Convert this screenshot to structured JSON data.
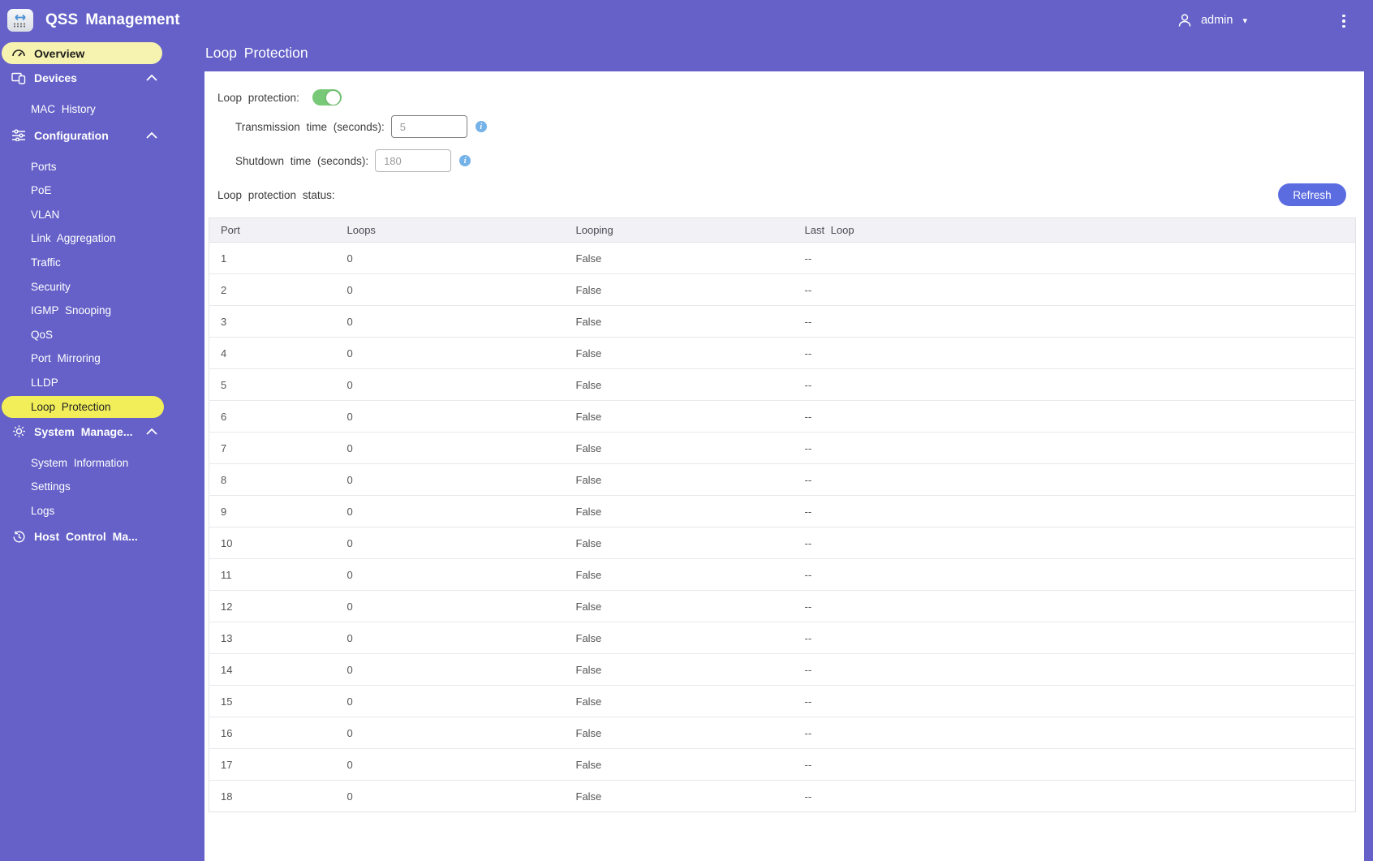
{
  "header": {
    "app_title": "QSS Management",
    "user": "admin"
  },
  "sidebar": {
    "overview": "Overview",
    "devices": {
      "label": "Devices",
      "items": [
        "MAC History"
      ]
    },
    "configuration": {
      "label": "Configuration",
      "items": [
        "Ports",
        "PoE",
        "VLAN",
        "Link Aggregation",
        "Traffic",
        "Security",
        "IGMP Snooping",
        "QoS",
        "Port Mirroring",
        "LLDP",
        "Loop Protection"
      ]
    },
    "system_management": {
      "label": "System Manage...",
      "items": [
        "System Information",
        "Settings",
        "Logs"
      ]
    },
    "host_control": {
      "label": "Host Control Ma..."
    }
  },
  "page": {
    "title": "Loop Protection",
    "toggle_label": "Loop protection:",
    "toggle_state": "on",
    "transmission": {
      "label": "Transmission time (seconds):",
      "value": "5"
    },
    "shutdown": {
      "label": "Shutdown time (seconds):",
      "value": "180"
    },
    "status_label": "Loop protection status:",
    "refresh_label": "Refresh"
  },
  "table": {
    "columns": [
      "Port",
      "Loops",
      "Looping",
      "Last Loop"
    ],
    "rows": [
      [
        "1",
        "0",
        "False",
        "--"
      ],
      [
        "2",
        "0",
        "False",
        "--"
      ],
      [
        "3",
        "0",
        "False",
        "--"
      ],
      [
        "4",
        "0",
        "False",
        "--"
      ],
      [
        "5",
        "0",
        "False",
        "--"
      ],
      [
        "6",
        "0",
        "False",
        "--"
      ],
      [
        "7",
        "0",
        "False",
        "--"
      ],
      [
        "8",
        "0",
        "False",
        "--"
      ],
      [
        "9",
        "0",
        "False",
        "--"
      ],
      [
        "10",
        "0",
        "False",
        "--"
      ],
      [
        "11",
        "0",
        "False",
        "--"
      ],
      [
        "12",
        "0",
        "False",
        "--"
      ],
      [
        "13",
        "0",
        "False",
        "--"
      ],
      [
        "14",
        "0",
        "False",
        "--"
      ],
      [
        "15",
        "0",
        "False",
        "--"
      ],
      [
        "16",
        "0",
        "False",
        "--"
      ],
      [
        "17",
        "0",
        "False",
        "--"
      ],
      [
        "18",
        "0",
        "False",
        "--"
      ]
    ]
  },
  "icons": {
    "logo": "switch-logo-icon",
    "overview": "gauge-icon",
    "devices": "devices-icon",
    "configuration": "sliders-icon",
    "system_management": "gear-icon",
    "host_control": "history-icon",
    "user": "person-icon",
    "menu": "kebab-menu-icon",
    "info": "info-icon"
  },
  "colors": {
    "background_purple": "#6561c8",
    "overview_pill_yellow": "#f6f3b0",
    "active_item_yellow": "#f1ee5a",
    "refresh_button_blue": "#5b6ce1",
    "toggle_green": "#77c877",
    "info_icon_blue": "#74b2e8",
    "table_header_bg": "#f2f2f6"
  }
}
